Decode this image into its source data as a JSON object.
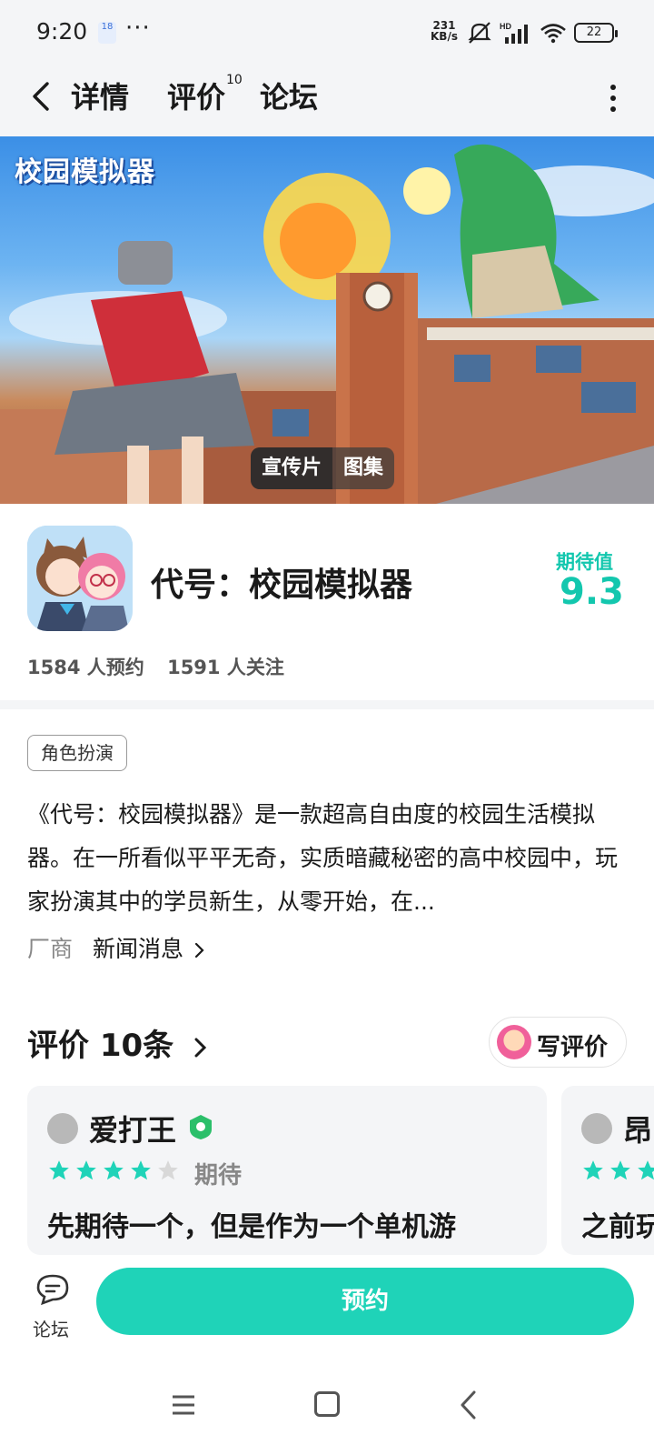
{
  "status_bar": {
    "time": "9:20",
    "badge": "18",
    "dots": "···",
    "speed_value": "231",
    "speed_unit": "KB/s",
    "battery": "22"
  },
  "nav": {
    "tabs": [
      {
        "label": "详情",
        "active": true
      },
      {
        "label": "评价",
        "count": "10"
      },
      {
        "label": "论坛"
      }
    ]
  },
  "banner": {
    "logo_text": "校园模拟器",
    "buttons": [
      "宣传片",
      "图集"
    ]
  },
  "game": {
    "title": "代号：校园模拟器",
    "expect_label": "期待值",
    "expect_value": "9.3",
    "reservations": "1584 人预约",
    "followers": "1591 人关注",
    "tag": "角色扮演",
    "description": "《代号：校园模拟器》是一款超高自由度的校园生活模拟器。在一所看似平平无奇，实质暗藏秘密的高中校园中，玩家扮演其中的学员新生，从零开始，在...",
    "vendor_label": "厂商",
    "vendor_link": "新闻消息"
  },
  "reviews": {
    "heading": "评价 10条",
    "write_button": "写评价",
    "cards": [
      {
        "user": "爱打王",
        "stars": 4,
        "max_stars": 5,
        "rating_word": "期待",
        "text": "先期待一个，但是作为一个单机游"
      },
      {
        "user": "昂",
        "text": "之前玩"
      }
    ]
  },
  "bottom": {
    "forum_label": "论坛",
    "reserve_button": "预约"
  },
  "colors": {
    "accent": "#1fd3b8",
    "star_on": "#1fd3b8",
    "star_off": "#d8d8d8"
  }
}
